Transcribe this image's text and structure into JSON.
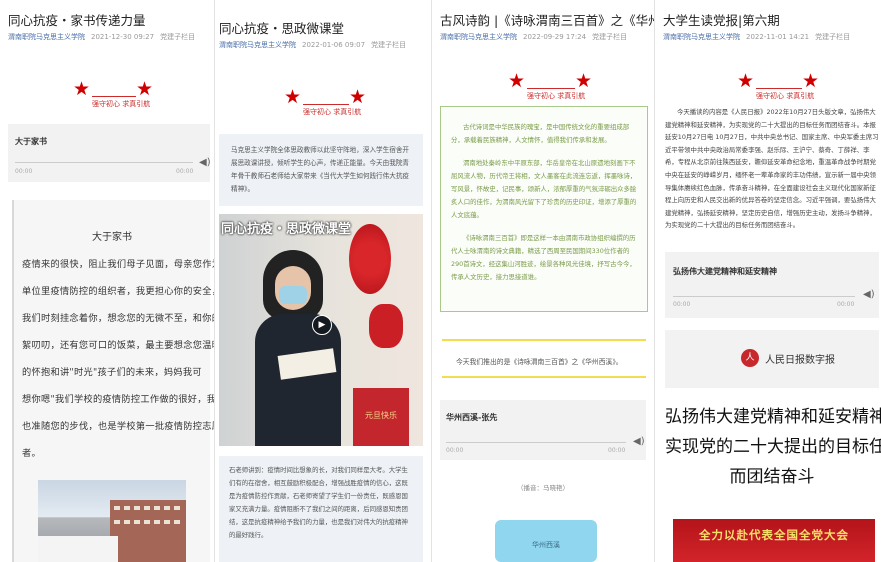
{
  "articles": [
    {
      "title": "同心抗疫・家书传递力量",
      "source": "渭南职院马克思主义学院",
      "date": "2021-12-30 09:27",
      "author": "党建子栏目",
      "banner_text": "强守初心 求真引航",
      "audio": {
        "title": "大于家书",
        "start": "00:00",
        "end": "00:00"
      },
      "letter": {
        "heading": "大于家书",
        "lines": [
          "疫情来的很快，阻止我们母子见面，母亲您作为",
          "单位里疫情防控的组织者，我更担心你的安全，",
          "我们时刻挂念着你，想念您的无微不至，和你的絮",
          "絮叨叨，还有您可口的饭菜，最主要想念您温暖",
          "的怀抱和讲\"时光\"孩子们的未来，妈妈我可",
          "想你嗯\"我们学校的疫情防控工作做的很好，我",
          "也准随您的步伐，也是学校第一批疫情防控志愿",
          "者。"
        ]
      }
    },
    {
      "title": "同心抗疫・思政微课堂",
      "source": "渭南职院马克思主义学院",
      "date": "2022-01-06 09:07",
      "author": "党建子栏目",
      "banner_text": "强守初心 求真引航",
      "intro": "马克思主义学院全体思政教师以此坚守阵地，深入学生宿舍开展思政课讲授，倾听学生的心声，传递正能量。今天由我院青年骨干教师石老师给大家带来《当代大学生如何践行伟大抗疫精神》。",
      "video_caption": "同心抗疫・思政微课堂",
      "poster_text": "元旦快乐",
      "summary": "石老师讲到：疫情时间比想象的长，对我们同样是大考。大学生们有的在宿舍，相互鼓励积极配合，增强战胜疫情的信心，这既是为疫情防控作贡献，石老师寄望了学生们一份责任，既感恩国家又充满力量。疫情阻断不了我们之间的距离，后同感恩知责团结，这是抗疫精神给予我们的力量，也是我们对伟大的抗疫精神的最好践行。"
    },
    {
      "title": "古风诗韵 |《诗咏渭南三百首》之《华州西溪》",
      "source": "渭南职院马克思主义学院",
      "date": "2022-09-29 17:24",
      "author": "党建子栏目",
      "banner_text": "强守初心 求真引航",
      "quote1": "古代诗词是中华民族的瑰宝，是中国传统文化的重要组成部分，承载着民族精神，人文情怀，值得我们传承和发展。",
      "quote2": "渭南地处秦岭东中平原东部，华岳皇帝在北山原遗地刻画下不屈风流人物，历代帝王将相，文人墨客在此流连忘返，挥墨咏诗，写风景，怀故史，记民事，颂新人，浓郁厚重的气氛淬砺出众多脍炙人口的佳作，为渭南风光留下了珍贵的历史印证，增添了厚重的人文底蕴。",
      "quote3": "《诗咏渭南三百首》即是这样一本由渭南市政协组织编撰的历代人士咏渭南的诗文典籍，精选了西周至民国期间330位作者的290首诗文，经这集山河胜迹，绘景各种风光佳境，抒写古今今，传承人文历史，接力思接道谁。",
      "read_line": "今天我们推出的是《诗咏渭南三百首》之《华州西溪》。",
      "audio": {
        "title": "华州西溪-张先",
        "start": "00:00",
        "end": "00:00"
      },
      "audio_note": "（播音：马晓艳）",
      "card_label": "华州西溪"
    },
    {
      "title": "大学生读党报|第六期",
      "source": "渭南职院马克思主义学院",
      "date": "2022-11-01 14:21",
      "author": "党建子栏目",
      "banner_text": "强守初心 求真引航",
      "body": "今天播读的内容是《人民日报》2022年10月27日头版文章，弘扬伟大建党精神和延安精神，为实现党的二十大提出的目标任务而团结奋斗。本报延安10月27日电 10月27日，中共中央总书记、国家主席、中央军委主席习近平带领中共中央政治局常委李强、赵乐际、王沪宁、蔡奇、丁薛祥、李希，专程从北京前往陕西延安，瞻仰延安革命纪念地，重温革命战争时期党中央在延安的峥嵘岁月，缅怀老一辈革命家的丰功伟绩，宣示新一届中央领导集体赓续红色血脉，传承奋斗精神，在全面建设社会主义现代化国家新征程上向历史和人民交出新的优异答卷的坚定信念。习近平强调，要弘扬伟大建党精神，弘扬延安精神，坚定历史自信，增强历史主动，发扬斗争精神，为实现党的二十大提出的目标任务而团结奋斗。",
      "audio": {
        "title": "弘扬伟大建党精神和延安精神",
        "start": "00:00",
        "end": "00:00"
      },
      "paper_name": "人民日报数字报",
      "headline_lines": [
        "弘扬伟大建党精神和延安精神为",
        "实现党的二十大提出的目标任务",
        "而团结奋斗"
      ],
      "banner_slogan": "全力以赴代表全国全党大会"
    }
  ]
}
